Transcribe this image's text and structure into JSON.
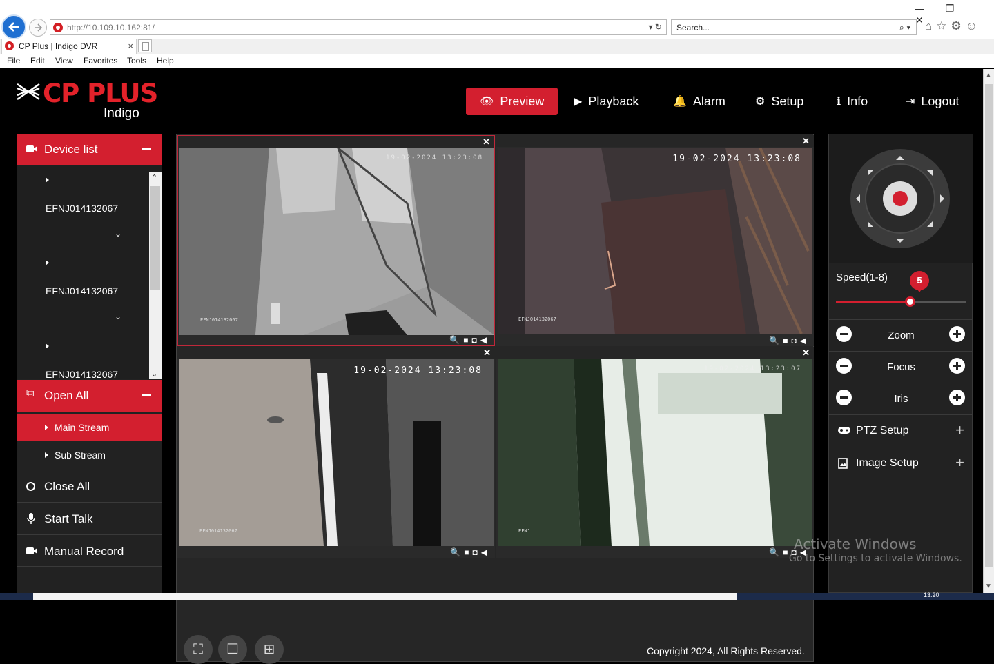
{
  "browser": {
    "url_host": "http://10.109.10.162",
    "url_port": ":81/",
    "search_placeholder": "Search...",
    "tab_title": "CP Plus | Indigo DVR",
    "menu": [
      "File",
      "Edit",
      "View",
      "Favorites",
      "Tools",
      "Help"
    ]
  },
  "app": {
    "brand": "CP PLUS",
    "brand_sub": "Indigo",
    "nav": {
      "preview": "Preview",
      "playback": "Playback",
      "alarm": "Alarm",
      "setup": "Setup",
      "info": "Info",
      "logout": "Logout"
    }
  },
  "left": {
    "device_list": "Device list",
    "devices": [
      "EFNJ014132067",
      "EFNJ014132067",
      "EFNJ014132067"
    ],
    "open_all": "Open All",
    "main_stream": "Main Stream",
    "sub_stream": "Sub Stream",
    "close_all": "Close All",
    "start_talk": "Start Talk",
    "manual_record": "Manual Record"
  },
  "cameras": [
    {
      "timestamp": "19-02-2024 13:23:08",
      "name": "EFNJ014132067"
    },
    {
      "timestamp": "19-02-2024 13:23:08",
      "name": "EFNJ014132067"
    },
    {
      "timestamp": "19-02-2024 13:23:08",
      "name": "EFNJ014132067"
    },
    {
      "timestamp": "19-02-2024 13:23:07",
      "name": "EFNJ"
    }
  ],
  "copyright": "Copyright 2024, All Rights Reserved.",
  "ptz": {
    "speed_label": "Speed(1-8)",
    "speed_value": "5",
    "speed_fraction": 0.57,
    "zoom": "Zoom",
    "focus": "Focus",
    "iris": "Iris",
    "ptz_setup": "PTZ Setup",
    "image_setup": "Image Setup"
  },
  "watermark": {
    "line1": "Activate Windows",
    "line2": "Go to Settings to activate Windows."
  },
  "taskbar_clock": "13:20",
  "colors": {
    "accent": "#d31f2f",
    "background": "#000000",
    "panel": "#222222"
  }
}
